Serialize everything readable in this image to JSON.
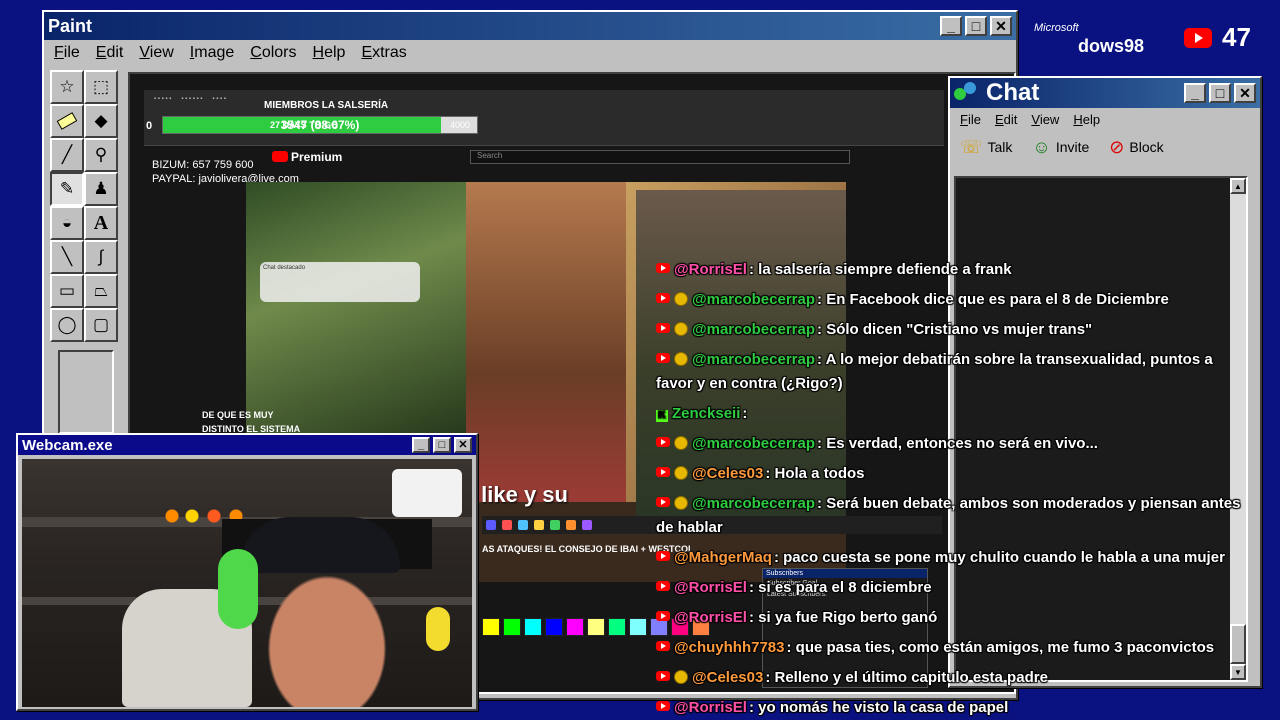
{
  "paint": {
    "title": "Paint",
    "menu": [
      "File",
      "Edit",
      "View",
      "Image",
      "Colors",
      "Help",
      "Extras"
    ],
    "tools": [
      "free-select-icon",
      "rect-select-icon",
      "eraser-icon",
      "fill-icon",
      "eyedropper-icon",
      "magnifier-icon",
      "pencil-icon",
      "brush-icon",
      "airbrush-icon",
      "text-icon",
      "line-icon",
      "curve-icon",
      "rectangle-icon",
      "polygon-icon",
      "ellipse-icon",
      "rounded-rect-icon"
    ],
    "text_tool_glyph": "A"
  },
  "stream": {
    "goal_label": "MIEMBROS LA SALSERÍA",
    "goal_text": "3547 (88.67%)",
    "goal_progress": 88.67,
    "goal_min": "0",
    "goal_max": "4000",
    "goal_days": "27 DAYS TO GO",
    "bizum": "BIZUM: 657 759 600",
    "paypal": "PAYPAL: javiolivera@live.com",
    "yt_premium": "Premium",
    "search_placeholder": "Search",
    "phone_text": "Chat destacado",
    "subtitle_line1": "DE QUE ES MUY",
    "subtitle_line2": "DISTINTO EL SISTEMA",
    "caption": "ale al like y su",
    "lower_text": "AS ATAQUES! EL CONSEJO DE IBAI + WESTCOL",
    "mini_panel_title": "Subscribers",
    "mini_panel_line1": "Subscriber Goal",
    "mini_panel_line2": "Latest Subscribers:",
    "palette": [
      "#ffff00",
      "#00ff00",
      "#00ffff",
      "#0000ff",
      "#ff00ff",
      "#ffff80",
      "#00ff80",
      "#80ffff",
      "#8080ff",
      "#ff0080",
      "#ff8040"
    ]
  },
  "chat": {
    "title": "Chat",
    "menu": [
      "File",
      "Edit",
      "View",
      "Help"
    ],
    "toolbar": {
      "talk": "Talk",
      "invite": "Invite",
      "block": "Block"
    },
    "messages": [
      {
        "user": "@RorrisEl",
        "color": "#ff4fa8",
        "text": ": la salsería siempre defiende a frank",
        "badge": false,
        "yt": true
      },
      {
        "user": "@marcobecerrap",
        "color": "#2ecc40",
        "text": ": En Facebook dice que es para el 8 de Diciembre",
        "badge": true,
        "yt": true
      },
      {
        "user": "@marcobecerrap",
        "color": "#2ecc40",
        "text": ": Sólo dicen \"Cristiano vs mujer trans\"",
        "badge": true,
        "yt": true
      },
      {
        "user": "@marcobecerrap",
        "color": "#2ecc40",
        "text": ": A lo mejor debatirán sobre la transexualidad, puntos a favor y en contra (¿Rigo?)",
        "badge": true,
        "yt": true,
        "wrap": true
      },
      {
        "user": "Zenckseii",
        "color": "#2ecc40",
        "text": ":",
        "badge": false,
        "yt": false,
        "kick": true
      },
      {
        "user": "@marcobecerrap",
        "color": "#2ecc40",
        "text": ": Es verdad, entonces no será en vivo...",
        "badge": true,
        "yt": true
      },
      {
        "user": "@Celes03",
        "color": "#ff9a3c",
        "text": ": Hola a todos",
        "badge": true,
        "yt": true
      },
      {
        "user": "@marcobecerrap",
        "color": "#2ecc40",
        "text": ": Será buen debate, ambos son moderados y piensan antes de hablar",
        "badge": true,
        "yt": true,
        "wrap": true
      },
      {
        "user": "@MahgerMaq",
        "color": "#ff9a3c",
        "text": ": paco cuesta se pone muy chulito cuando le habla a una mujer",
        "badge": false,
        "yt": true
      },
      {
        "user": "@RorrisEl",
        "color": "#ff4fa8",
        "text": ": si es para el 8 diciembre",
        "badge": false,
        "yt": true
      },
      {
        "user": "@RorrisEl",
        "color": "#ff4fa8",
        "text": ": si ya fue Rigo berto ganó",
        "badge": false,
        "yt": true
      },
      {
        "user": "@chuyhhh7783",
        "color": "#ff9a3c",
        "text": ": que pasa ties, como están amigos, me fumo 3 paconvictos",
        "badge": false,
        "yt": true
      },
      {
        "user": "@Celes03",
        "color": "#ff9a3c",
        "text": ": Relleno y el último capitulo esta padre",
        "badge": true,
        "yt": true
      },
      {
        "user": "@RorrisEl",
        "color": "#ff4fa8",
        "text": ": yo nomás he visto la casa de papel",
        "badge": false,
        "yt": true
      }
    ]
  },
  "webcam": {
    "title": "Webcam.exe"
  },
  "overlay": {
    "microsoft": "Microsoft",
    "windows": "dows98",
    "yt_viewers": "47"
  }
}
